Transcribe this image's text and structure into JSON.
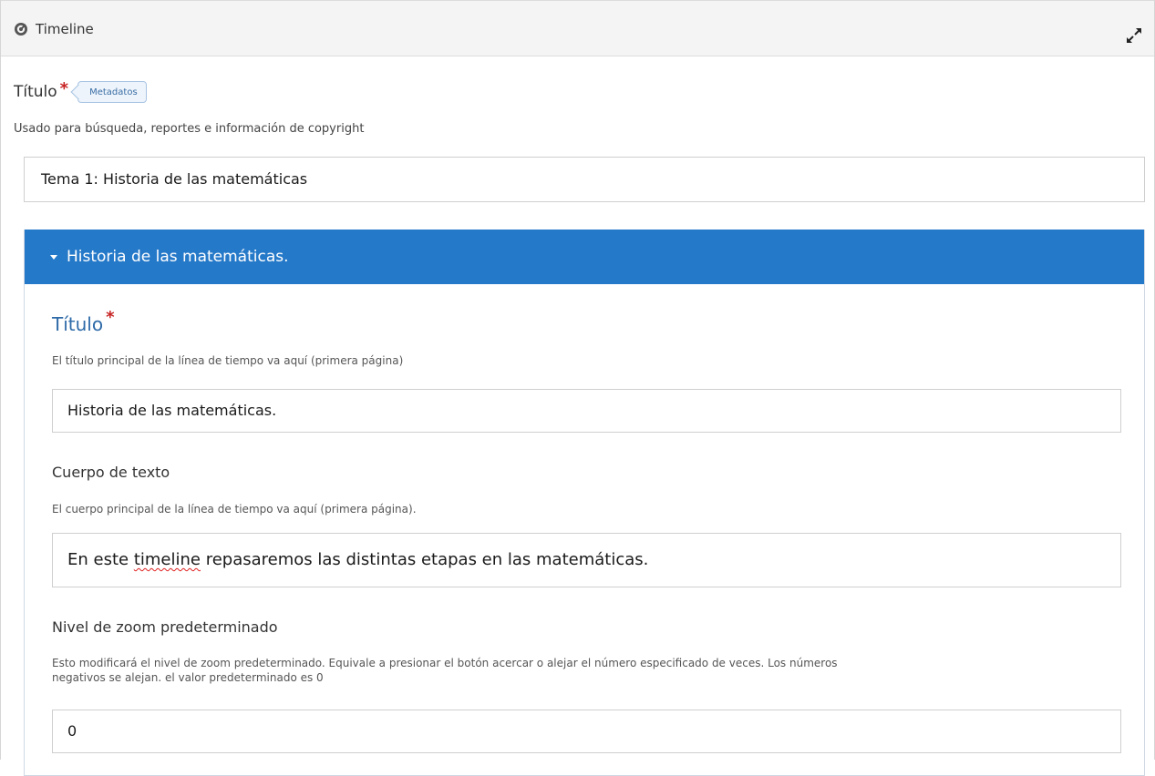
{
  "header": {
    "title": "Timeline"
  },
  "main": {
    "title_label": "Título",
    "required_mark": "*",
    "metadata_tag": "Metadatos",
    "title_description": "Usado para búsqueda, reportes e información de copyright",
    "title_value": "Tema 1: Historia de las matemáticas"
  },
  "group": {
    "header_title": "Historia de las matemáticas.",
    "title_label": "Título",
    "required_mark": "*",
    "title_description": "El título principal de la línea de tiempo va aquí (primera página)",
    "title_value": "Historia de las matemáticas.",
    "body_label": "Cuerpo de texto",
    "body_description": "El cuerpo principal de la línea de tiempo va aquí (primera página).",
    "body_before": "En este ",
    "body_misspelled": "timeline",
    "body_after": " repasaremos las distintas etapas en las matemáticas.",
    "zoom_label": "Nivel de zoom predeterminado",
    "zoom_description_1": "Esto modificará el nivel de zoom predeterminado. Equivale a presionar el botón acercar o alejar el número especificado de veces. Los números",
    "zoom_description_2": "negativos se alejan. el valor predeterminado es 0",
    "zoom_value": "0"
  },
  "colors": {
    "accent": "#2579c9",
    "required": "#c72222",
    "subtitle": "#2e6aa8"
  },
  "icons": {
    "header_icon": "timeline-icon",
    "expand_icon": "expand-icon",
    "caret_icon": "caret-down-icon"
  }
}
